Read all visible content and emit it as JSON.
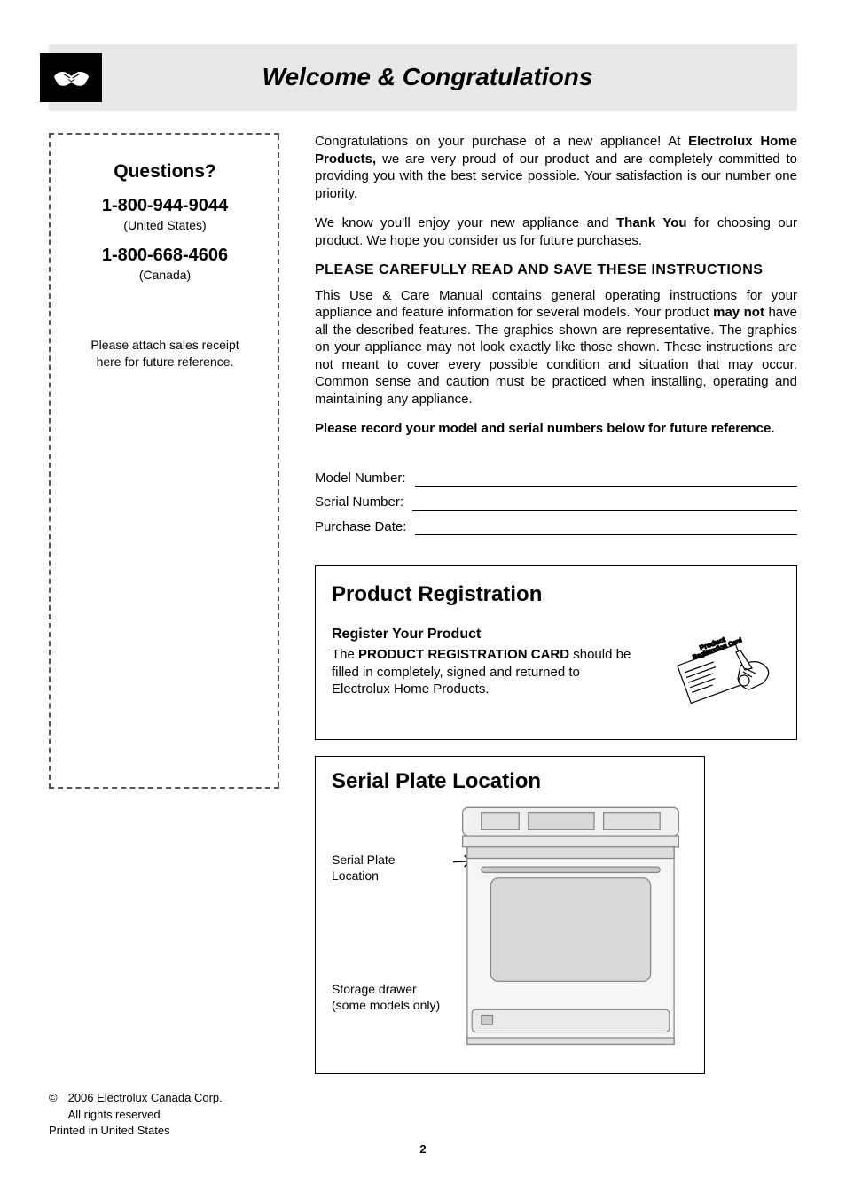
{
  "header": {
    "title": "Welcome & Congratulations"
  },
  "sidebar": {
    "questions_label": "Questions?",
    "phone_us": "1-800-944-9044",
    "phone_us_sub": "(United States)",
    "phone_ca": "1-800-668-4606",
    "phone_ca_sub": "(Canada)",
    "note_line1": "Please attach sales receipt",
    "note_line2": "here for future reference."
  },
  "intro": {
    "p1_a": "Congratulations on your purchase of a new appliance! At ",
    "p1_b": "Electrolux Home Products,",
    "p1_c": " we are very proud of our product and are completely committed to providing you with the best service possible. Your satisfaction is our number one priority.",
    "p2_a": "We know you'll enjoy your new appliance and ",
    "p2_b": "Thank You",
    "p2_c": " for choosing our product. We hope you consider us for future purchases.",
    "heading": "PLEASE CAREFULLY READ AND SAVE THESE INSTRUCTIONS",
    "p3_a": "This Use & Care Manual contains general operating instructions for your appliance and feature information for several models. Your product ",
    "p3_b": "may not",
    "p3_c": " have all the described features.  The graphics shown are representative. The graphics on your appliance may not look exactly like those shown. These instructions are not meant to cover every possible condition and situation that may occur. Common sense and caution must be practiced when installing, operating and maintaining any appliance.",
    "record_note": "Please record your model and serial numbers below for future reference."
  },
  "fields": {
    "model": "Model Number:",
    "serial": "Serial Number:",
    "purchase": "Purchase Date:"
  },
  "registration": {
    "title": "Product Registration",
    "subtitle": "Register Your Product",
    "text_a": "The ",
    "text_b": "PRODUCT REGISTRATION CARD",
    "text_c": " should be filled in completely, signed and returned to Electrolux Home Products.",
    "card_text1": "Product",
    "card_text2": "Registration Card"
  },
  "serial_plate": {
    "title": "Serial Plate Location",
    "label1": "Serial Plate Location",
    "label2_a": "Storage drawer",
    "label2_b": "(some models only)"
  },
  "footer": {
    "copyright_symbol": "©",
    "copyright_text": "2006 Electrolux Canada Corp.",
    "rights": "All rights reserved",
    "printed": "Printed in United States",
    "page": "2"
  }
}
